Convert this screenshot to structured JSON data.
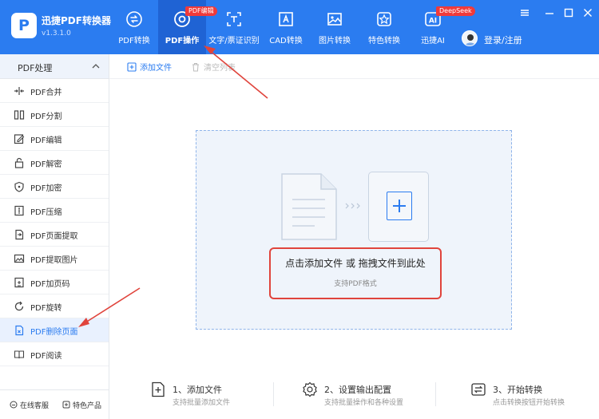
{
  "app": {
    "title": "迅捷PDF转换器",
    "version": "v1.3.1.0",
    "logo_letter": "P"
  },
  "nav": {
    "tabs": [
      {
        "label": "PDF转换",
        "icon": "pdf-convert-icon"
      },
      {
        "label": "PDF操作",
        "icon": "pdf-operate-icon",
        "active": true,
        "badge": "PDF编辑"
      },
      {
        "label": "文字/票证识别",
        "icon": "ocr-icon"
      },
      {
        "label": "CAD转换",
        "icon": "cad-icon"
      },
      {
        "label": "图片转换",
        "icon": "image-icon"
      },
      {
        "label": "特色转换",
        "icon": "star-icon"
      },
      {
        "label": "迅捷AI",
        "icon": "ai-icon",
        "badge": "DeepSeek",
        "icon_text": "AI"
      }
    ],
    "login_label": "登录/注册"
  },
  "sidebar": {
    "header": "PDF处理",
    "items": [
      {
        "label": "PDF合并",
        "icon": "merge-icon"
      },
      {
        "label": "PDF分割",
        "icon": "split-icon"
      },
      {
        "label": "PDF编辑",
        "icon": "edit-icon"
      },
      {
        "label": "PDF解密",
        "icon": "unlock-icon"
      },
      {
        "label": "PDF加密",
        "icon": "shield-icon"
      },
      {
        "label": "PDF压缩",
        "icon": "compress-icon"
      },
      {
        "label": "PDF页面提取",
        "icon": "extract-page-icon"
      },
      {
        "label": "PDF提取图片",
        "icon": "extract-image-icon"
      },
      {
        "label": "PDF加页码",
        "icon": "page-number-icon"
      },
      {
        "label": "PDF旋转",
        "icon": "rotate-icon"
      },
      {
        "label": "PDF删除页面",
        "icon": "delete-page-icon",
        "active": true
      },
      {
        "label": "PDF阅读",
        "icon": "read-icon"
      }
    ],
    "footer": {
      "service": "在线客服",
      "featured": "特色产品"
    }
  },
  "toolbar": {
    "add_file": "添加文件",
    "clear_list": "清空列表"
  },
  "dropzone": {
    "main_text": "点击添加文件 或 拖拽文件到此处",
    "sub_text": "支持PDF格式"
  },
  "steps": [
    {
      "title": "1、添加文件",
      "subtitle": "支持批量添加文件",
      "icon": "add-file-icon"
    },
    {
      "title": "2、设置输出配置",
      "subtitle": "支持批量操作和各种设置",
      "icon": "settings-gear-icon"
    },
    {
      "title": "3、开始转换",
      "subtitle": "点击转换按钮开始转换",
      "icon": "start-convert-icon"
    }
  ],
  "colors": {
    "primary": "#2b7cf0",
    "header_active": "#1f63d4",
    "badge_red": "#f03a3a",
    "annotation_red": "#e0443c"
  }
}
